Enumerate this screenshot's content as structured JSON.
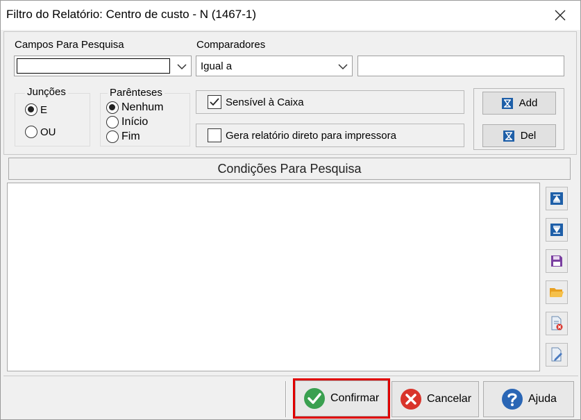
{
  "window": {
    "title": "Filtro do Relatório: Centro de custo - N (1467-1)",
    "close_glyph": "✕"
  },
  "search": {
    "campos_label": "Campos Para Pesquisa",
    "campos_value": "",
    "comparadores_label": "Comparadores",
    "comparador_value": "Igual a",
    "valor_value": ""
  },
  "juncoes": {
    "caption": "Junções",
    "options": [
      {
        "label": "E",
        "selected": true
      },
      {
        "label": "OU",
        "selected": false
      }
    ]
  },
  "parenteses": {
    "caption": "Parênteses",
    "options": [
      {
        "label": "Nenhum",
        "selected": true
      },
      {
        "label": "Início",
        "selected": false
      },
      {
        "label": "Fim",
        "selected": false
      }
    ]
  },
  "options": {
    "case_sensitive_label": "Sensível à Caixa",
    "case_sensitive_checked": true,
    "direct_print_label": "Gera relatório direto para impressora",
    "direct_print_checked": false
  },
  "actions": {
    "add_label": "Add",
    "del_label": "Del"
  },
  "conditions": {
    "header": "Condições Para Pesquisa",
    "items": []
  },
  "side_tools": [
    "move-up-icon",
    "move-down-icon",
    "save-icon",
    "open-folder-icon",
    "delete-file-icon",
    "edit-file-icon"
  ],
  "footer": {
    "confirm_label": "Confirmar",
    "cancel_label": "Cancelar",
    "help_label": "Ajuda"
  },
  "colors": {
    "accent_blue": "#1e5fa8",
    "confirm_green": "#3aa050",
    "cancel_red": "#d9342b",
    "help_blue": "#2a66b5",
    "highlight_red": "#e00000"
  }
}
